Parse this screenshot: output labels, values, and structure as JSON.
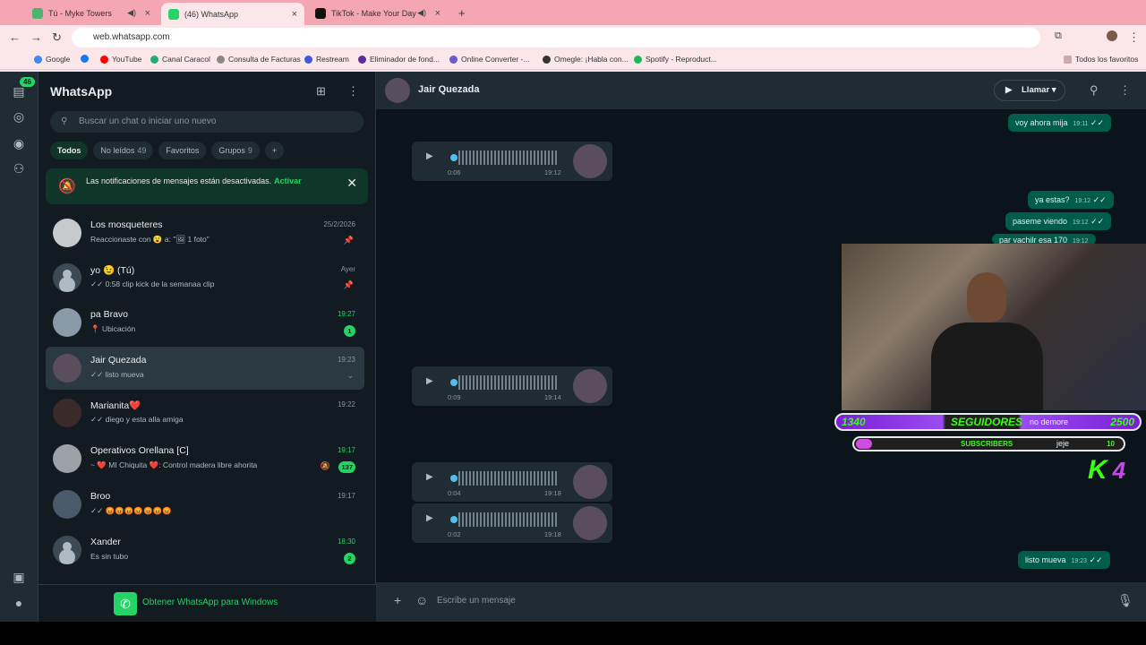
{
  "browser": {
    "tabs": [
      {
        "title": "Tú - Myke Towers"
      },
      {
        "title": "(46) WhatsApp"
      },
      {
        "title": "TikTok - Make Your Day"
      }
    ],
    "url": "web.whatsapp.com",
    "bookmarks": [
      "Google",
      "YouTube",
      "Canal Caracol",
      "Consulta de Facturas",
      "Restream",
      "Eliminador de fond...",
      "Online Converter -...",
      "Omegle: ¡Habla con...",
      "Spotify - Reproduct..."
    ],
    "all_bookmarks": "Todos los favoritos"
  },
  "rail": {
    "unread_badge": "46"
  },
  "sidebar": {
    "title": "WhatsApp",
    "search_placeholder": "Buscar un chat o iniciar uno nuevo",
    "chips": [
      {
        "label": "Todos",
        "count": ""
      },
      {
        "label": "No leídos",
        "count": "49"
      },
      {
        "label": "Favoritos",
        "count": ""
      },
      {
        "label": "Grupos",
        "count": "9"
      },
      {
        "label": "+",
        "count": ""
      }
    ],
    "notice": {
      "text": "Las notificaciones de mensajes están desactivadas.",
      "action": "Activar"
    },
    "chats": [
      {
        "name": "Los mosqueteres",
        "msg": "Reaccionaste con 😮 a: \"🖼 1 foto\"",
        "time": "25/2/2026",
        "badge": ""
      },
      {
        "name": "yo 😉 (Tú)",
        "msg": "✓✓ 0:58 clip kick de la semanaa clip",
        "time": "Ayer",
        "badge": ""
      },
      {
        "name": "pa Bravo",
        "msg": "📍 Ubicación",
        "time": "19:27",
        "badge": "1"
      },
      {
        "name": "Jair Quezada",
        "msg": "✓✓ listo mueva",
        "time": "19:23",
        "badge": ""
      },
      {
        "name": "Marianita❤️",
        "msg": "✓✓ diego y esta alla amiga",
        "time": "19:22",
        "badge": ""
      },
      {
        "name": "Operativos Orellana [C]",
        "msg": "~ ❤️ MI Chiquita ❤️: Control madera libre ahorita",
        "time": "19:17",
        "badge": "137"
      },
      {
        "name": "Broo",
        "msg": "✓✓ 😡😡😡😡😡😡😡",
        "time": "19:17",
        "badge": ""
      },
      {
        "name": "Xander",
        "msg": "Es sin tubo",
        "time": "18:30",
        "badge": "2"
      }
    ],
    "get_windows": "Obtener WhatsApp para Windows"
  },
  "conversation": {
    "contact": "Jair Quezada",
    "call_label": "Llamar",
    "messages": [
      {
        "text": "voy ahora mija",
        "time": "19:11"
      },
      {
        "text": "ya estas?",
        "time": "19:12"
      },
      {
        "text": "paseme viendo",
        "time": "19:12"
      },
      {
        "text": "par vachilr esa 170",
        "time": "19:12"
      },
      {
        "text": "no demore",
        "time": "19:15"
      },
      {
        "text": "jeje",
        "time": "19:15"
      },
      {
        "text": "listo mueva",
        "time": "19:23"
      }
    ],
    "audios": [
      {
        "duration": "0:06",
        "time": "19:12"
      },
      {
        "duration": "0:09",
        "time": "19:14"
      },
      {
        "duration": "0:04",
        "time": "19:18"
      },
      {
        "duration": "0:02",
        "time": "19:18"
      }
    ],
    "composer_placeholder": "Escribe un mensaje"
  },
  "stream_overlay": {
    "followers_current": "1340",
    "followers_label": "SEGUIDORES",
    "followers_goal": "2500",
    "subs_label": "SUBSCRIBERS",
    "subs_goal": "10",
    "logo": "K",
    "logo_number": "4"
  },
  "colors": {
    "accent": "#25d366",
    "outgoing": "#005c4b",
    "panel": "#111b21",
    "tab_bar": "#f4a6b3"
  }
}
